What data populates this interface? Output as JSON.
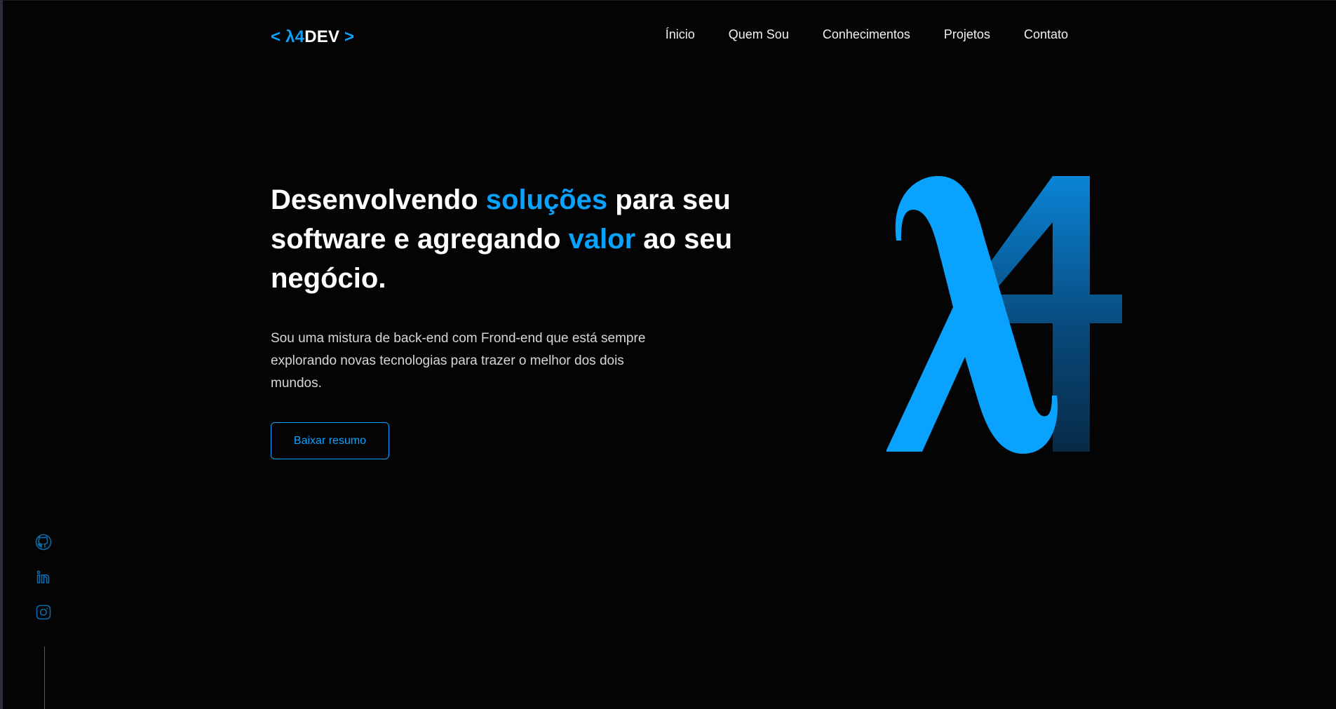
{
  "brand": {
    "open_bracket": "<",
    "lambda": "λ4",
    "name": "DEV",
    "close_bracket": ">"
  },
  "nav": {
    "items": [
      {
        "label": "Ínicio"
      },
      {
        "label": "Quem Sou"
      },
      {
        "label": "Conhecimentos"
      },
      {
        "label": "Projetos"
      },
      {
        "label": "Contato"
      }
    ]
  },
  "hero": {
    "headline_part1": "Desenvolvendo ",
    "headline_highlight1": "soluções",
    "headline_part2": " para seu software e agregando ",
    "headline_highlight2": "valor",
    "headline_part3": " ao seu negócio.",
    "description": "Sou uma mistura de back-end com Frond-end que está sempre explorando novas tecnologias para trazer o melhor dos dois mundos.",
    "cta_label": "Baixar resumo",
    "art_icon": "lambda-4-logo-icon"
  },
  "social": {
    "icons": [
      "github-icon",
      "linkedin-icon",
      "instagram-icon"
    ]
  },
  "colors": {
    "accent": "#0aa2ff",
    "background": "#040405",
    "text": "#ffffff",
    "muted": "#d6d6d6",
    "social_icon": "#0a6fb0"
  }
}
